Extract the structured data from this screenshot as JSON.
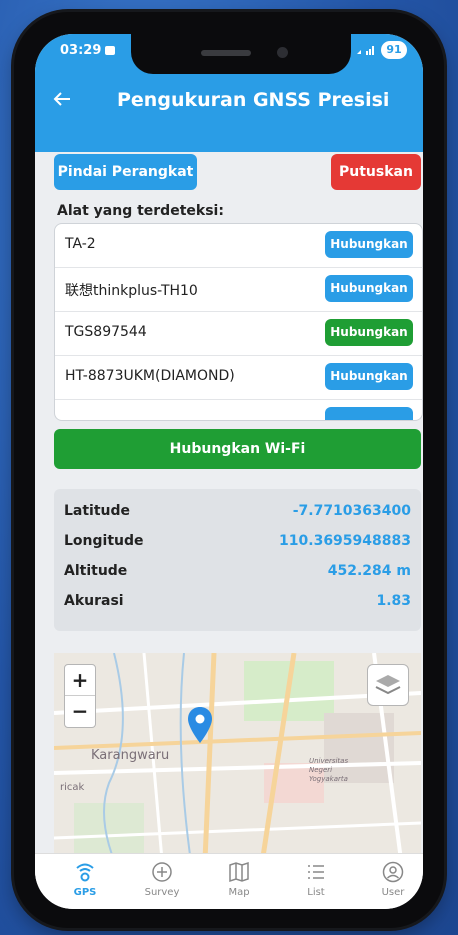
{
  "status": {
    "time": "03:29",
    "battery": "91"
  },
  "header": {
    "title": "Pengukuran GNSS Presisi"
  },
  "actions": {
    "scan_label": "Pindai Perangkat",
    "disconnect_label": "Putuskan"
  },
  "devices": {
    "heading": "Alat yang terdeteksi:",
    "items": [
      {
        "name": "TA-2",
        "button": "Hubungkan",
        "button_color": "#2a9de6"
      },
      {
        "name": "联想thinkplus-TH10",
        "button": "Hubungkan",
        "button_color": "#2a9de6"
      },
      {
        "name": "TGS897544",
        "button": "Hubungkan",
        "button_color": "#1f9e34"
      },
      {
        "name": "HT-8873UKM(DIAMOND)",
        "button": "Hubungkan",
        "button_color": "#2a9de6"
      }
    ]
  },
  "wifi": {
    "label": "Hubungkan Wi-Fi"
  },
  "coordinates": [
    {
      "label": "Latitude",
      "value": "-7.7710363400"
    },
    {
      "label": "Longitude",
      "value": "110.3695948883"
    },
    {
      "label": "Altitude",
      "value": "452.284 m"
    },
    {
      "label": "Akurasi",
      "value": "1.83"
    }
  ],
  "map": {
    "zoom_in": "+",
    "zoom_out": "−",
    "labels": {
      "karangwaru": "Karangwaru",
      "ricak": "ricak",
      "university": "Universitas Negeri Yogyakarta"
    },
    "marker_color": "#2a8be3"
  },
  "nav": [
    {
      "label": "GPS",
      "icon": "gps-icon",
      "active": true
    },
    {
      "label": "Survey",
      "icon": "plus-circle-icon",
      "active": false
    },
    {
      "label": "Map",
      "icon": "map-icon",
      "active": false
    },
    {
      "label": "List",
      "icon": "list-icon",
      "active": false
    },
    {
      "label": "User",
      "icon": "user-icon",
      "active": false
    }
  ],
  "colors": {
    "primary": "#2a9de6",
    "danger": "#e53935",
    "success": "#1f9e34"
  }
}
